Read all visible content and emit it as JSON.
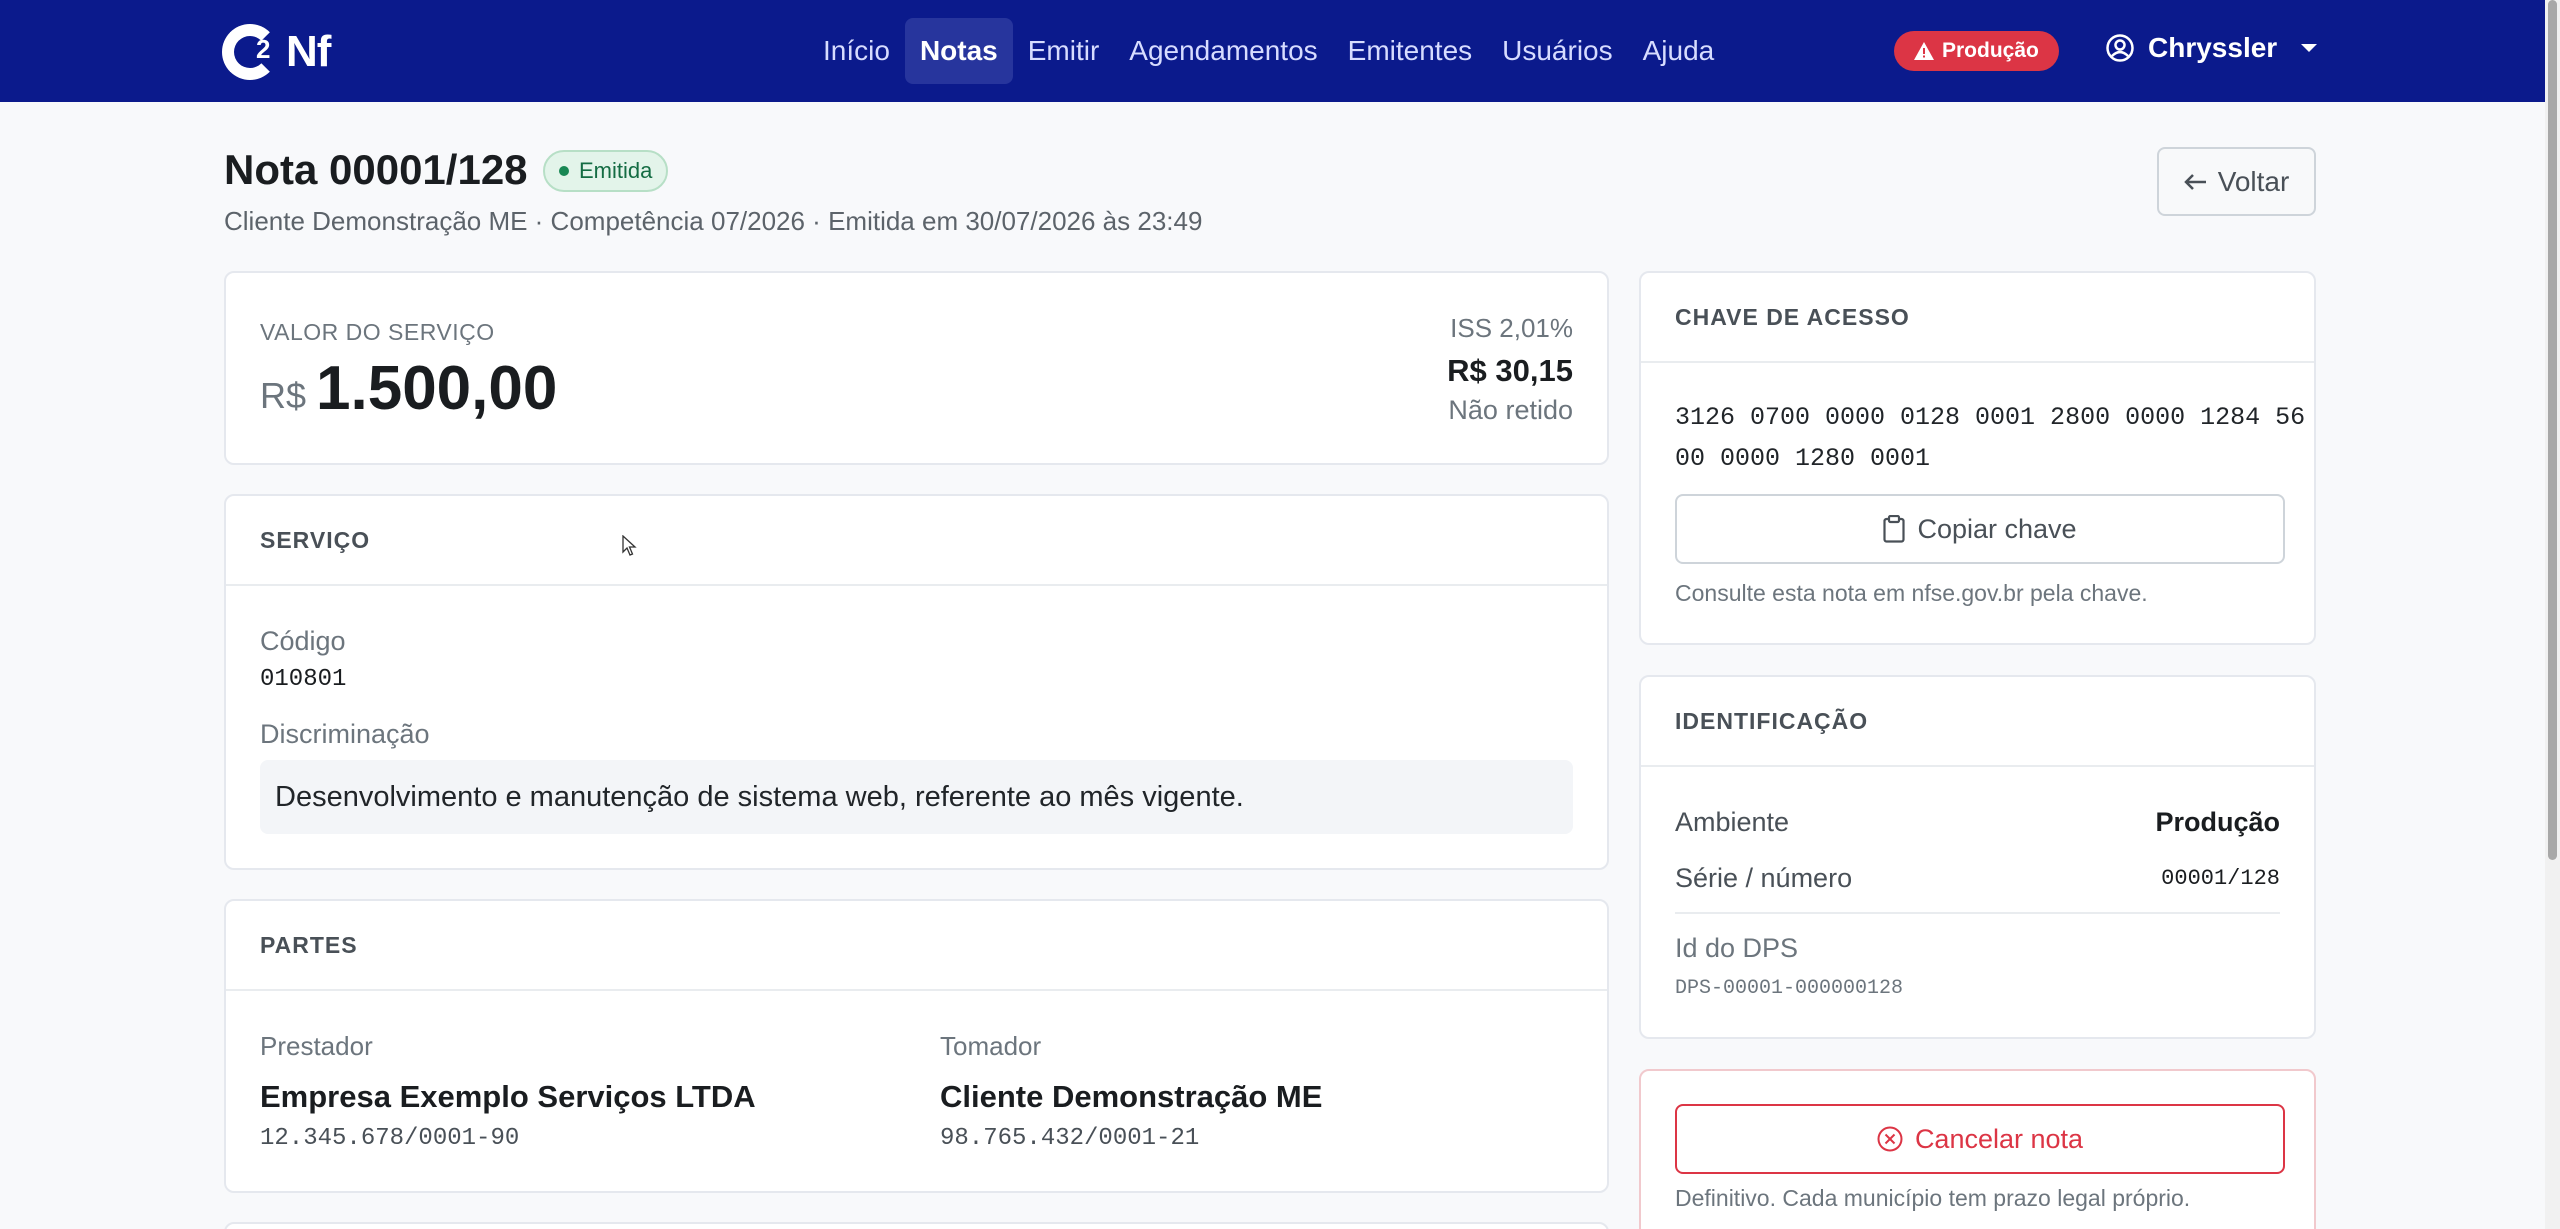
{
  "brand": {
    "logo_text": "Nf",
    "logo_super": "2"
  },
  "nav": {
    "items": [
      {
        "label": "Início"
      },
      {
        "label": "Notas"
      },
      {
        "label": "Emitir"
      },
      {
        "label": "Agendamentos"
      },
      {
        "label": "Emitentes"
      },
      {
        "label": "Usuários"
      },
      {
        "label": "Ajuda"
      }
    ],
    "active": "Notas",
    "env_badge": "Produção",
    "user": "Chryssler"
  },
  "header": {
    "title": "Nota 00001/128",
    "status": "Emitida",
    "subtitle": "Cliente Demonstração ME · Competência 07/2026 · Emitida em 30/07/2026 às 23:49",
    "back_label": "Voltar"
  },
  "valor": {
    "label": "VALOR DO SERVIÇO",
    "currency": "R$",
    "amount": "1.500,00",
    "iss_rate": "ISS 2,01%",
    "iss_value": "R$ 30,15",
    "iss_status": "Não retido"
  },
  "servico": {
    "title": "SERVIÇO",
    "codigo_label": "Código",
    "codigo": "010801",
    "discriminacao_label": "Discriminação",
    "discriminacao": "Desenvolvimento e manutenção de sistema web, referente ao mês vigente."
  },
  "partes": {
    "title": "PARTES",
    "prestador_label": "Prestador",
    "prestador_nome": "Empresa Exemplo Serviços LTDA",
    "prestador_doc": "12.345.678/0001-90",
    "tomador_label": "Tomador",
    "tomador_nome": "Cliente Demonstração ME",
    "tomador_doc": "98.765.432/0001-21"
  },
  "chave": {
    "title": "CHAVE DE ACESSO",
    "line1": "3126 0700 0000 0128 0001 2800 0000 1284 56",
    "line2": "00 0000 1280 0001",
    "copy_label": "Copiar chave",
    "note": "Consulte esta nota em nfse.gov.br pela chave."
  },
  "identificacao": {
    "title": "IDENTIFICAÇÃO",
    "ambiente_label": "Ambiente",
    "ambiente": "Produção",
    "serie_label": "Série / número",
    "serie": "00001/128",
    "dps_label": "Id do DPS",
    "dps": "DPS-00001-000000128"
  },
  "cancelar": {
    "label": "Cancelar nota",
    "note": "Definitivo. Cada município tem prazo legal próprio."
  }
}
